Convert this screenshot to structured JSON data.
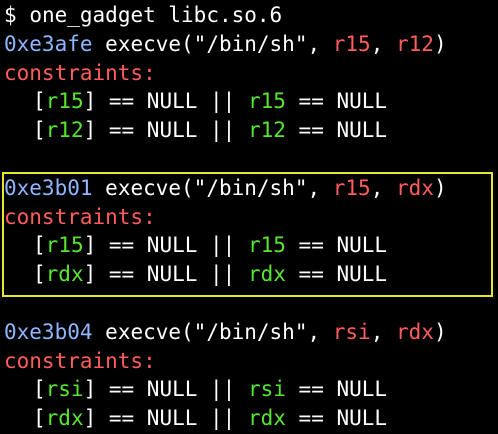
{
  "prompt": {
    "symbol": "$",
    "command": "one_gadget libc.so.6"
  },
  "keyword_constraints": "constraints:",
  "gadgets": [
    {
      "address": "0xe3afe",
      "call": "execve(\"/bin/sh\",",
      "arg1": "r15",
      "sep": ",",
      "arg2": "r12",
      "close": ")",
      "constraints": [
        {
          "open": "[",
          "reg1": "r15",
          "mid1": "] == NULL || ",
          "reg2": "r15",
          "tail": " == NULL"
        },
        {
          "open": "[",
          "reg1": "r12",
          "mid1": "] == NULL || ",
          "reg2": "r12",
          "tail": " == NULL"
        }
      ]
    },
    {
      "address": "0xe3b01",
      "call": "execve(\"/bin/sh\",",
      "arg1": "r15",
      "sep": ",",
      "arg2": "rdx",
      "close": ")",
      "highlighted": true,
      "constraints": [
        {
          "open": "[",
          "reg1": "r15",
          "mid1": "] == NULL || ",
          "reg2": "r15",
          "tail": " == NULL"
        },
        {
          "open": "[",
          "reg1": "rdx",
          "mid1": "] == NULL || ",
          "reg2": "rdx",
          "tail": " == NULL"
        }
      ]
    },
    {
      "address": "0xe3b04",
      "call": "execve(\"/bin/sh\",",
      "arg1": "rsi",
      "sep": ",",
      "arg2": "rdx",
      "close": ")",
      "constraints": [
        {
          "open": "[",
          "reg1": "rsi",
          "mid1": "] == NULL || ",
          "reg2": "rsi",
          "tail": " == NULL"
        },
        {
          "open": "[",
          "reg1": "rdx",
          "mid1": "] == NULL || ",
          "reg2": "rdx",
          "tail": " == NULL"
        }
      ]
    }
  ],
  "colors": {
    "background": "#000000",
    "address": "#8fb6ff",
    "keyword": "#ff5c5c",
    "register": "#55e62d",
    "highlight_border": "#e6e62a"
  }
}
